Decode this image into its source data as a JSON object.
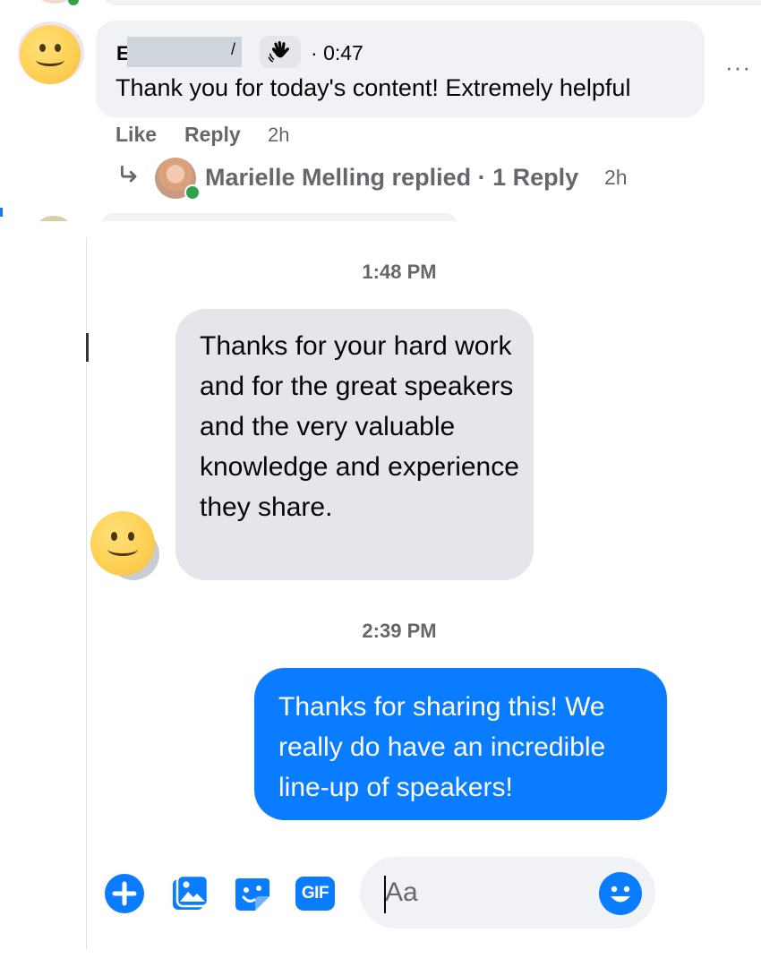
{
  "comment": {
    "author_initial": "E",
    "author_tail": "/",
    "timestamp": "0:47",
    "separator": "·",
    "text": "Thank you for today's content! Extremely helpful",
    "more_label": "···",
    "actions": {
      "like": "Like",
      "reply": "Reply",
      "age": "2h"
    },
    "reply_summary": {
      "arrow": "↳",
      "text": "Marielle Melling replied · 1 Reply",
      "age": "2h"
    }
  },
  "messenger": {
    "stamp_1": "1:48 PM",
    "incoming_text": "Thanks for your hard work and for the great speakers and the very valuable knowledge and experience they share.",
    "stamp_2": "2:39 PM",
    "outgoing_text": "Thanks for sharing this! We really do have an incredible line-up of speakers!",
    "composer": {
      "placeholder": "Aa",
      "gif_label": "GIF",
      "icons": [
        "plus-icon",
        "photo-icon",
        "sticker-icon",
        "gif-icon",
        "emoji-icon"
      ]
    }
  },
  "colors": {
    "accent_blue": "#0a7cff",
    "bubble_gray": "#e4e6eb",
    "comment_bubble": "#f0f2f5",
    "secondary_text": "#65676b",
    "online_green": "#31a24c"
  }
}
